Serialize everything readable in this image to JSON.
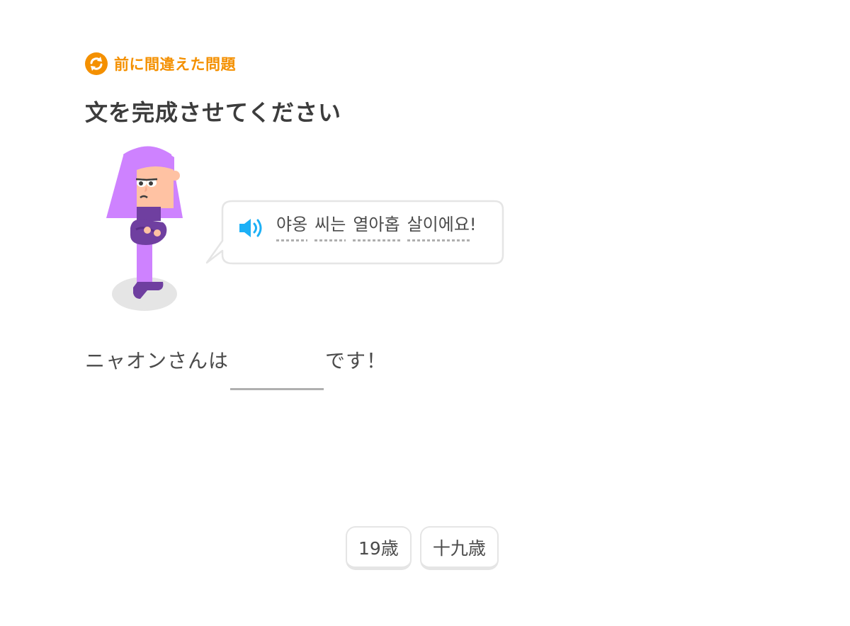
{
  "review_tag": {
    "label": "前に間違えた問題",
    "icon": "refresh-icon",
    "color": "#f49000"
  },
  "prompt": {
    "title": "文を完成させてください"
  },
  "character": {
    "icon": "lily-character"
  },
  "speech": {
    "icon": "speaker-icon",
    "words": [
      "야옹",
      "씨는",
      "열아홉",
      "살이에요"
    ],
    "punctuation": "!"
  },
  "sentence": {
    "before": "ニャオンさんは",
    "after": "です！"
  },
  "word_bank": {
    "options": [
      "19歳",
      "十九歳"
    ]
  },
  "colors": {
    "accent_orange": "#f49000",
    "speaker_blue": "#1cb0f6",
    "hair_purple": "#ce82ff",
    "outfit_purple": "#6f3fa0",
    "border_gray": "#e5e5e5"
  }
}
